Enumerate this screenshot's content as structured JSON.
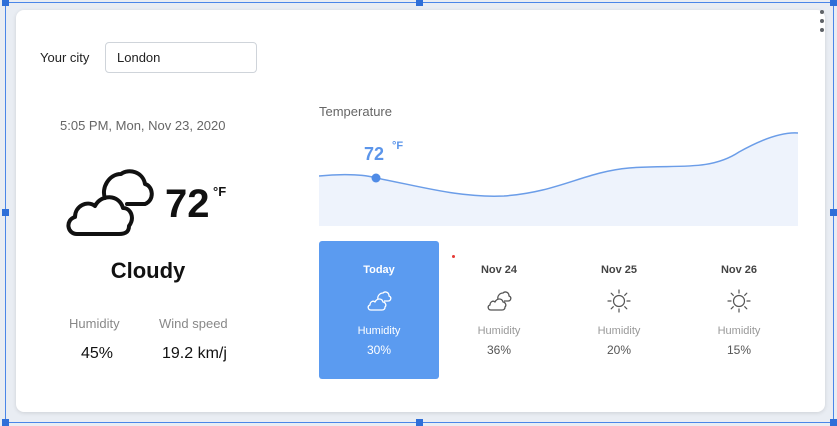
{
  "city": {
    "label": "Your city",
    "value": "London"
  },
  "current": {
    "datetime": "5:05 PM, Mon, Nov 23, 2020",
    "temperature": "72",
    "unit": "°F",
    "condition": "Cloudy",
    "icon": "cloud-icon",
    "humidity_label": "Humidity",
    "humidity": "45%",
    "wind_label": "Wind speed",
    "wind": "19.2 km/j"
  },
  "chart": {
    "title": "Temperature",
    "highlight_value": "72",
    "highlight_unit": "°F",
    "colors": {
      "line": "#6b9de8",
      "fill": "#eef3fc",
      "point": "#4f8be6"
    }
  },
  "forecast": [
    {
      "day": "Today",
      "icon": "cloud-icon",
      "humidity_label": "Humidity",
      "humidity": "30%",
      "active": true
    },
    {
      "day": "Nov 24",
      "icon": "cloud-icon",
      "humidity_label": "Humidity",
      "humidity": "36%",
      "active": false
    },
    {
      "day": "Nov 25",
      "icon": "sun-icon",
      "humidity_label": "Humidity",
      "humidity": "20%",
      "active": false
    },
    {
      "day": "Nov 26",
      "icon": "sun-icon",
      "humidity_label": "Humidity",
      "humidity": "15%",
      "active": false
    }
  ],
  "colors": {
    "accent": "#5b9bf0",
    "selection": "#2f6fd8"
  }
}
